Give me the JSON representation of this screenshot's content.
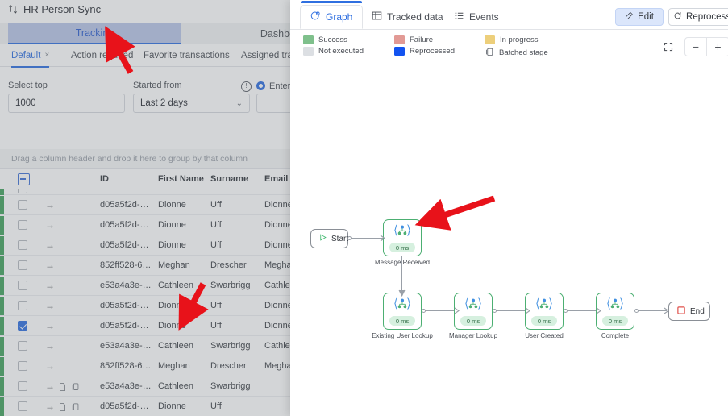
{
  "left_panel": {
    "title": "HR Person Sync",
    "title_icon": "sync-arrows-icon",
    "nav_tabs": [
      {
        "label": "Tracking",
        "active": true
      },
      {
        "label": "Dashboar",
        "active": false
      }
    ],
    "sub_tabs": [
      {
        "label": "Default",
        "active": true,
        "closable": true,
        "close_label": "×"
      },
      {
        "label": "Action required",
        "active": false
      },
      {
        "label": "Favorite transactions",
        "active": false
      },
      {
        "label": "Assigned tra",
        "active": false
      }
    ],
    "filters": {
      "select_top_label": "Select top",
      "select_top_value": "1000",
      "started_from_label": "Started from",
      "started_from_value": "Last 2 days",
      "info_icon": "info-circle-icon",
      "radio_label": "Enter",
      "chevron": "⌄"
    },
    "group_bar_text": "Drag a column header and drop it here to group by that column",
    "table": {
      "columns": [
        "ID",
        "First Name",
        "Surname",
        "Email"
      ],
      "select_all_state": "indeterminate",
      "rows": [
        {
          "id": "d05a5f2d-…",
          "first": "Dionne",
          "surname": "Uff",
          "email": "Dionne",
          "selected": false,
          "status": "success",
          "extra_icons": []
        },
        {
          "id": "d05a5f2d-…",
          "first": "Dionne",
          "surname": "Uff",
          "email": "Dionne",
          "selected": false,
          "status": "success",
          "extra_icons": []
        },
        {
          "id": "d05a5f2d-…",
          "first": "Dionne",
          "surname": "Uff",
          "email": "Dionne",
          "selected": false,
          "status": "success",
          "extra_icons": []
        },
        {
          "id": "852ff528-6…",
          "first": "Meghan",
          "surname": "Drescher",
          "email": "Megha",
          "selected": false,
          "status": "success",
          "extra_icons": []
        },
        {
          "id": "e53a4a3e-…",
          "first": "Cathleen",
          "surname": "Swarbrigg",
          "email": "Cathle",
          "selected": false,
          "status": "success",
          "extra_icons": []
        },
        {
          "id": "d05a5f2d-…",
          "first": "Dionne",
          "surname": "Uff",
          "email": "Dionne",
          "selected": false,
          "status": "success",
          "extra_icons": []
        },
        {
          "id": "d05a5f2d-…",
          "first": "Dionne",
          "surname": "Uff",
          "email": "Dionne",
          "selected": true,
          "status": "success",
          "extra_icons": []
        },
        {
          "id": "e53a4a3e-…",
          "first": "Cathleen",
          "surname": "Swarbrigg",
          "email": "Cathle",
          "selected": false,
          "status": "success",
          "extra_icons": []
        },
        {
          "id": "852ff528-6…",
          "first": "Meghan",
          "surname": "Drescher",
          "email": "Megha",
          "selected": false,
          "status": "success",
          "extra_icons": []
        },
        {
          "id": "e53a4a3e-…",
          "first": "Cathleen",
          "surname": "Swarbrigg",
          "email": "",
          "selected": false,
          "status": "success",
          "extra_icons": [
            "document-icon",
            "copy-icon"
          ]
        },
        {
          "id": "d05a5f2d-…",
          "first": "Dionne",
          "surname": "Uff",
          "email": "",
          "selected": false,
          "status": "success",
          "extra_icons": [
            "document-icon",
            "copy-icon"
          ]
        }
      ]
    }
  },
  "right_panel": {
    "tabs": [
      {
        "label": "Graph",
        "icon": "graph-icon",
        "active": true
      },
      {
        "label": "Tracked data",
        "icon": "table-icon",
        "active": false
      },
      {
        "label": "Events",
        "icon": "list-icon",
        "active": false
      }
    ],
    "actions": [
      {
        "label": "Edit",
        "icon": "edit-pencil-icon",
        "primary": true
      },
      {
        "label": "Reprocess",
        "icon": "refresh-icon",
        "primary": false
      }
    ],
    "legend": [
      {
        "label": "Success",
        "color": "#7fc08c",
        "type": "swatch"
      },
      {
        "label": "Failure",
        "color": "#e29a95",
        "type": "swatch"
      },
      {
        "label": "In progress",
        "color": "#edcf7b",
        "type": "swatch"
      },
      {
        "label": "Not executed",
        "color": "#dcdfe3",
        "type": "swatch"
      },
      {
        "label": "Reprocessed",
        "color": "#1353f0",
        "type": "swatch"
      },
      {
        "label": "Batched stage",
        "color": "#5c6169",
        "type": "icon",
        "icon": "batched-stage-icon"
      }
    ],
    "zoom_controls": [
      {
        "name": "fit-screen-icon",
        "label": "⌧"
      },
      {
        "name": "zoom-out-button",
        "label": "−"
      },
      {
        "name": "zoom-in-button",
        "label": "+"
      }
    ],
    "graph": {
      "start_label": "Start",
      "end_label": "End",
      "nodes": [
        {
          "caption": "Message Received",
          "duration": "0 ms",
          "status": "success"
        },
        {
          "caption": "Existing User Lookup",
          "duration": "0 ms",
          "status": "success"
        },
        {
          "caption": "Manager Lookup",
          "duration": "0 ms",
          "status": "success"
        },
        {
          "caption": "User Created",
          "duration": "0 ms",
          "status": "success"
        },
        {
          "caption": "Complete",
          "duration": "0 ms",
          "status": "success"
        }
      ]
    }
  },
  "annotations": {
    "arrow_color": "#e8121a",
    "arrows": [
      "tracking-tab-arrow",
      "table-row-arrow",
      "message-received-node-arrow"
    ]
  }
}
